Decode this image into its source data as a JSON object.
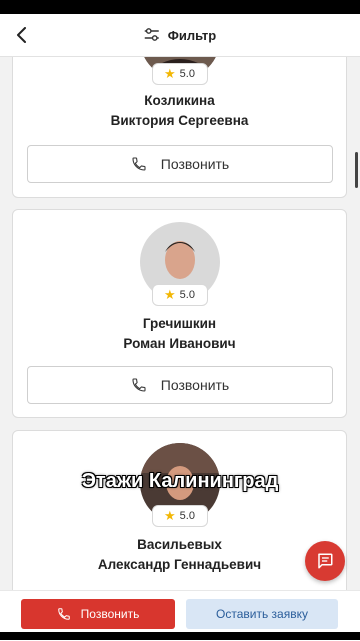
{
  "header": {
    "filter_label": "Фильтр"
  },
  "agents": [
    {
      "surname": "Козликина",
      "given": "Виктория Сергеевна",
      "rating": "5.0",
      "call_label": "Позвонить"
    },
    {
      "surname": "Гречишкин",
      "given": "Роман Иванович",
      "rating": "5.0",
      "call_label": "Позвонить"
    },
    {
      "surname": "Васильевых",
      "given": "Александр Геннадьевич",
      "rating": "5.0",
      "call_label": "Позвонить"
    }
  ],
  "overlay_text": "Этажи Калининград",
  "bottom": {
    "call_label": "Позвонить",
    "request_label": "Оставить заявку"
  },
  "colors": {
    "accent_red": "#d8362e",
    "request_bg": "#d9e6f5",
    "request_text": "#2a5d9a",
    "star": "#f2b705"
  }
}
